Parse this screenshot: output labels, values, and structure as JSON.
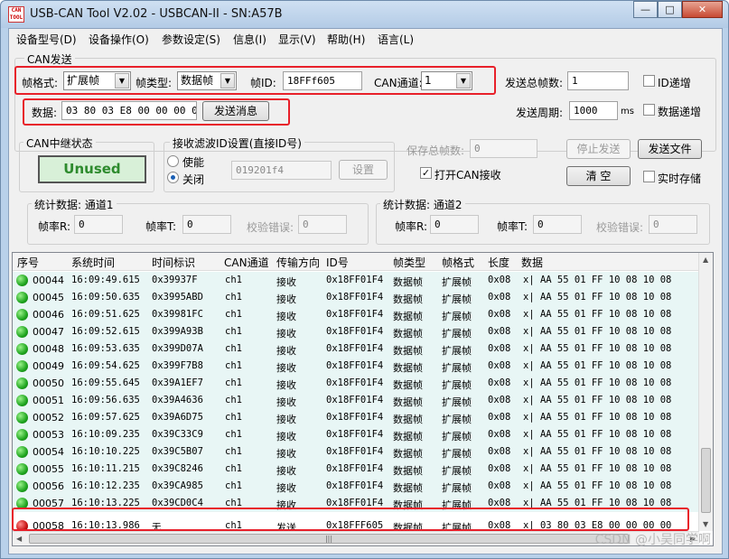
{
  "window": {
    "title": "USB-CAN Tool V2.02 - USBCAN-II - SN:A57B",
    "icon_text": "CAN TOOL"
  },
  "menu": [
    "设备型号(D)",
    "设备操作(O)",
    "参数设定(S)",
    "信息(I)",
    "显示(V)",
    "帮助(H)",
    "语言(L)"
  ],
  "can_send": {
    "group_title": "CAN发送",
    "frame_format_label": "帧格式:",
    "frame_format_value": "扩展帧",
    "frame_type_label": "帧类型:",
    "frame_type_value": "数据帧",
    "frame_id_label": "帧ID:",
    "frame_id_value": "18FFf605",
    "can_channel_label": "CAN通道:",
    "can_channel_value": "1",
    "data_label": "数据:",
    "data_value": "03 80 03 E8 00 00 00 00",
    "send_button": "发送消息",
    "total_frames_label": "发送总帧数:",
    "total_frames_value": "1",
    "id_increment_label": "ID递增",
    "send_period_label": "发送周期:",
    "send_period_value": "1000",
    "send_period_unit": "ms",
    "data_increment_label": "数据递增"
  },
  "relay": {
    "group_title": "CAN中继状态",
    "status": "Unused"
  },
  "filter": {
    "group_title": "接收滤波ID设置(直接ID号)",
    "enable_label": "使能",
    "disable_label": "关闭",
    "selected": "disable",
    "id_value": "019201f4",
    "set_button": "设置"
  },
  "right_controls": {
    "save_total_label": "保存总帧数:",
    "save_total_value": "0",
    "open_can_receive_label": "打开CAN接收",
    "open_can_receive_checked": true,
    "stop_send_button": "停止发送",
    "send_file_button": "发送文件",
    "clear_button": "清  空",
    "realtime_save_label": "实时存储"
  },
  "stats": [
    {
      "title": "统计数据: 通道1",
      "rate_r_label": "帧率R:",
      "rate_r": "0",
      "rate_t_label": "帧率T:",
      "rate_t": "0",
      "check_err_label": "校验错误:",
      "check_err": "0"
    },
    {
      "title": "统计数据: 通道2",
      "rate_r_label": "帧率R:",
      "rate_r": "0",
      "rate_t_label": "帧率T:",
      "rate_t": "0",
      "check_err_label": "校验错误:",
      "check_err": "0"
    }
  ],
  "table": {
    "columns": [
      "序号",
      "系统时间",
      "时间标识",
      "CAN通道",
      "传输方向",
      "ID号",
      "帧类型",
      "帧格式",
      "长度",
      "数据"
    ],
    "rows": [
      {
        "status": "green",
        "seq": "00044",
        "time": "16:09:49.615",
        "stamp": "0x39937F",
        "ch": "ch1",
        "dir": "接收",
        "id": "0x18FF01F4",
        "type": "数据帧",
        "format": "扩展帧",
        "len": "0x08",
        "data": "x| AA 55 01 FF 10 08 10 08"
      },
      {
        "status": "green",
        "seq": "00045",
        "time": "16:09:50.635",
        "stamp": "0x3995ABD",
        "ch": "ch1",
        "dir": "接收",
        "id": "0x18FF01F4",
        "type": "数据帧",
        "format": "扩展帧",
        "len": "0x08",
        "data": "x| AA 55 01 FF 10 08 10 08"
      },
      {
        "status": "green",
        "seq": "00046",
        "time": "16:09:51.625",
        "stamp": "0x39981FC",
        "ch": "ch1",
        "dir": "接收",
        "id": "0x18FF01F4",
        "type": "数据帧",
        "format": "扩展帧",
        "len": "0x08",
        "data": "x| AA 55 01 FF 10 08 10 08"
      },
      {
        "status": "green",
        "seq": "00047",
        "time": "16:09:52.615",
        "stamp": "0x399A93B",
        "ch": "ch1",
        "dir": "接收",
        "id": "0x18FF01F4",
        "type": "数据帧",
        "format": "扩展帧",
        "len": "0x08",
        "data": "x| AA 55 01 FF 10 08 10 08"
      },
      {
        "status": "green",
        "seq": "00048",
        "time": "16:09:53.635",
        "stamp": "0x399D07A",
        "ch": "ch1",
        "dir": "接收",
        "id": "0x18FF01F4",
        "type": "数据帧",
        "format": "扩展帧",
        "len": "0x08",
        "data": "x| AA 55 01 FF 10 08 10 08"
      },
      {
        "status": "green",
        "seq": "00049",
        "time": "16:09:54.625",
        "stamp": "0x399F7B8",
        "ch": "ch1",
        "dir": "接收",
        "id": "0x18FF01F4",
        "type": "数据帧",
        "format": "扩展帧",
        "len": "0x08",
        "data": "x| AA 55 01 FF 10 08 10 08"
      },
      {
        "status": "green",
        "seq": "00050",
        "time": "16:09:55.645",
        "stamp": "0x39A1EF7",
        "ch": "ch1",
        "dir": "接收",
        "id": "0x18FF01F4",
        "type": "数据帧",
        "format": "扩展帧",
        "len": "0x08",
        "data": "x| AA 55 01 FF 10 08 10 08"
      },
      {
        "status": "green",
        "seq": "00051",
        "time": "16:09:56.635",
        "stamp": "0x39A4636",
        "ch": "ch1",
        "dir": "接收",
        "id": "0x18FF01F4",
        "type": "数据帧",
        "format": "扩展帧",
        "len": "0x08",
        "data": "x| AA 55 01 FF 10 08 10 08"
      },
      {
        "status": "green",
        "seq": "00052",
        "time": "16:09:57.625",
        "stamp": "0x39A6D75",
        "ch": "ch1",
        "dir": "接收",
        "id": "0x18FF01F4",
        "type": "数据帧",
        "format": "扩展帧",
        "len": "0x08",
        "data": "x| AA 55 01 FF 10 08 10 08"
      },
      {
        "status": "green",
        "seq": "00053",
        "time": "16:10:09.235",
        "stamp": "0x39C33C9",
        "ch": "ch1",
        "dir": "接收",
        "id": "0x18FF01F4",
        "type": "数据帧",
        "format": "扩展帧",
        "len": "0x08",
        "data": "x| AA 55 01 FF 10 08 10 08"
      },
      {
        "status": "green",
        "seq": "00054",
        "time": "16:10:10.225",
        "stamp": "0x39C5B07",
        "ch": "ch1",
        "dir": "接收",
        "id": "0x18FF01F4",
        "type": "数据帧",
        "format": "扩展帧",
        "len": "0x08",
        "data": "x| AA 55 01 FF 10 08 10 08"
      },
      {
        "status": "green",
        "seq": "00055",
        "time": "16:10:11.215",
        "stamp": "0x39C8246",
        "ch": "ch1",
        "dir": "接收",
        "id": "0x18FF01F4",
        "type": "数据帧",
        "format": "扩展帧",
        "len": "0x08",
        "data": "x| AA 55 01 FF 10 08 10 08"
      },
      {
        "status": "green",
        "seq": "00056",
        "time": "16:10:12.235",
        "stamp": "0x39CA985",
        "ch": "ch1",
        "dir": "接收",
        "id": "0x18FF01F4",
        "type": "数据帧",
        "format": "扩展帧",
        "len": "0x08",
        "data": "x| AA 55 01 FF 10 08 10 08"
      },
      {
        "status": "green",
        "seq": "00057",
        "time": "16:10:13.225",
        "stamp": "0x39CD0C4",
        "ch": "ch1",
        "dir": "接收",
        "id": "0x18FF01F4",
        "type": "数据帧",
        "format": "扩展帧",
        "len": "0x08",
        "data": "x| AA 55 01 FF 10 08 10 08"
      },
      {
        "status": "red",
        "seq": "00058",
        "time": "16:10:13.986",
        "stamp": "无",
        "ch": "ch1",
        "dir": "发送",
        "id": "0x18FFF605",
        "type": "数据帧",
        "format": "扩展帧",
        "len": "0x08",
        "data": "x| 03 80 03 E8 00 00 00 00"
      }
    ]
  },
  "watermark": "CSDN @小吴同学啊"
}
